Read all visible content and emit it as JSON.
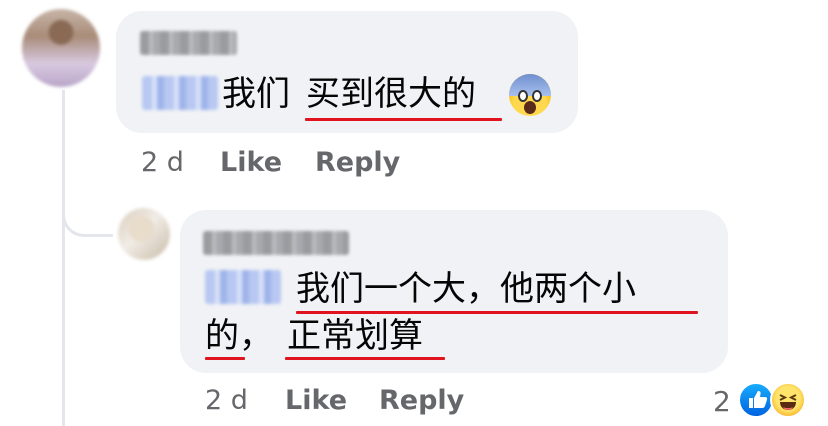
{
  "comment": {
    "text_parts": [
      "我们",
      "买到很大的"
    ],
    "time": "2 d",
    "like_label": "Like",
    "reply_label": "Reply",
    "emoji": "face-screaming-in-fear-icon"
  },
  "reply": {
    "line1_parts": [
      "我们一个大，他两个小"
    ],
    "line2_parts": [
      "的，",
      "正常划算"
    ],
    "time": "2 d",
    "like_label": "Like",
    "reply_label": "Reply",
    "reaction_count": "2",
    "reactions": [
      "like-icon",
      "haha-icon"
    ]
  },
  "colors": {
    "bubble": "#f0f2f5",
    "underline": "#e0141e",
    "meta": "#65676b",
    "like": "#0866ff"
  }
}
